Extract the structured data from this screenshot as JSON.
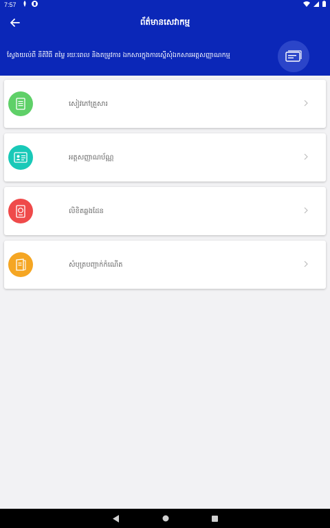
{
  "status_bar": {
    "time": "7:57"
  },
  "app_bar": {
    "title": "ព័ត៌មានសេវាកម្ម"
  },
  "banner": {
    "text": "ស្វែងយល់ពី នីតិវិធី តម្លៃ រយៈពេល និងតម្រូវការ ឯកសារក្នុងការស្នើសុំឯកសារអត្តសញ្ញាណកម្ម"
  },
  "services": [
    {
      "label": "សៀវភៅគ្រួសារ",
      "color": "#5fd068",
      "icon": "document-icon"
    },
    {
      "label": "អត្តសញ្ញាណប័ណ្ណ",
      "color": "#19c9b8",
      "icon": "id-card-icon"
    },
    {
      "label": "លិខិតឆ្លងដែន",
      "color": "#ef4a4a",
      "icon": "passport-icon"
    },
    {
      "label": "សំបុត្របញ្ជាក់កំណើត",
      "color": "#f5a623",
      "icon": "booklet-icon"
    }
  ],
  "colors": {
    "primary": "#0b27b8",
    "background": "#f2f2f4"
  }
}
